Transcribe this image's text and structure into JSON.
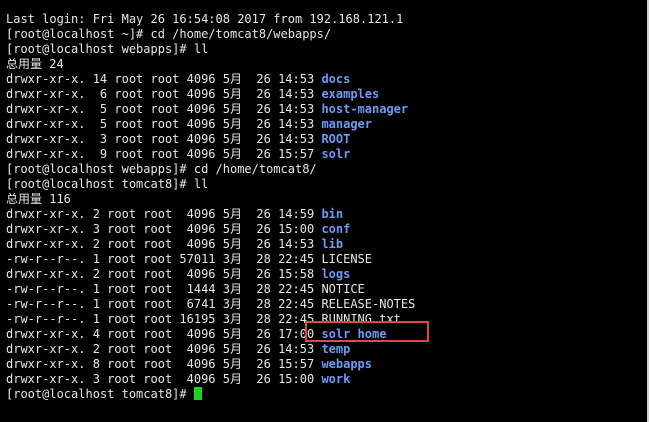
{
  "colors": {
    "background": "#000000",
    "text": "#e6e6e6",
    "directory": "#6a9cf5",
    "cursor": "#19d41a",
    "highlight": "#e0454b"
  },
  "terminal": {
    "login": "Last login: Fri May 26 16:54:08 2017 from 192.168.121.1",
    "cmd1": "[root@localhost ~]# cd /home/tomcat8/webapps/",
    "cmd2": "[root@localhost webapps]# ll",
    "total1": "总用量 24",
    "listing1": [
      {
        "meta": "drwxr-xr-x. 14 root root 4096 5月  26 14:53 ",
        "name": "docs"
      },
      {
        "meta": "drwxr-xr-x.  6 root root 4096 5月  26 14:53 ",
        "name": "examples"
      },
      {
        "meta": "drwxr-xr-x.  5 root root 4096 5月  26 14:53 ",
        "name": "host-manager"
      },
      {
        "meta": "drwxr-xr-x.  5 root root 4096 5月  26 14:53 ",
        "name": "manager"
      },
      {
        "meta": "drwxr-xr-x.  3 root root 4096 5月  26 14:53 ",
        "name": "ROOT"
      },
      {
        "meta": "drwxr-xr-x.  9 root root 4096 5月  26 15:57 ",
        "name": "solr"
      }
    ],
    "cmd3": "[root@localhost webapps]# cd /home/tomcat8/",
    "cmd4": "[root@localhost tomcat8]# ll",
    "total2": "总用量 116",
    "listing2": [
      {
        "meta": "drwxr-xr-x. 2 root root  4096 5月  26 14:59 ",
        "name": "bin"
      },
      {
        "meta": "drwxr-xr-x. 3 root root  4096 5月  26 15:00 ",
        "name": "conf"
      },
      {
        "meta": "drwxr-xr-x. 2 root root  4096 5月  26 14:53 ",
        "name": "lib"
      },
      {
        "meta": "-rw-r--r--. 1 root root 57011 3月  28 22:45 ",
        "name": "LICENSE"
      },
      {
        "meta": "drwxr-xr-x. 2 root root  4096 5月  26 15:58 ",
        "name": "logs"
      },
      {
        "meta": "-rw-r--r--. 1 root root  1444 3月  28 22:45 ",
        "name": "NOTICE"
      },
      {
        "meta": "-rw-r--r--. 1 root root  6741 3月  28 22:45 ",
        "name": "RELEASE-NOTES"
      },
      {
        "meta": "-rw-r--r--. 1 root root 16195 3月  28 22:45 ",
        "name": "RUNNING.txt"
      },
      {
        "meta": "drwxr-xr-x. 4 root root  4096 5月  26 17:00 ",
        "name": "solr_home"
      },
      {
        "meta": "drwxr-xr-x. 2 root root  4096 5月  26 14:53 ",
        "name": "temp"
      },
      {
        "meta": "drwxr-xr-x. 8 root root  4096 5月  26 15:57 ",
        "name": "webapps"
      },
      {
        "meta": "drwxr-xr-x. 3 root root  4096 5月  26 15:00 ",
        "name": "work"
      }
    ],
    "prompt": "[root@localhost tomcat8]# "
  }
}
